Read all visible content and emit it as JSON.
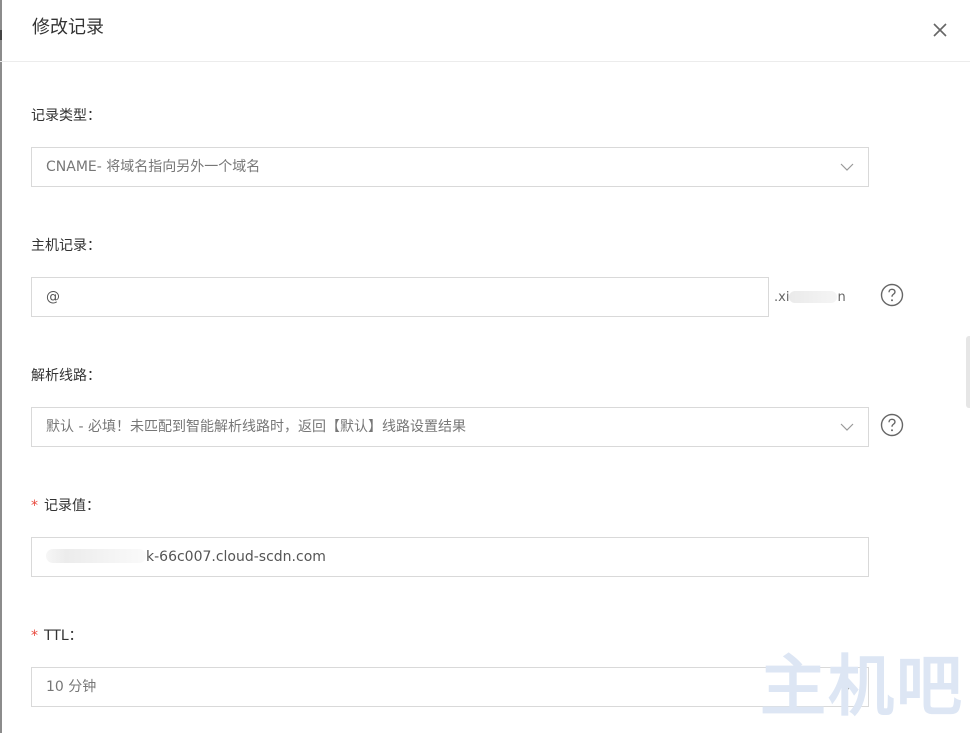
{
  "dialog": {
    "title": "修改记录"
  },
  "record_type": {
    "label": "记录类型：",
    "value": "CNAME- 将域名指向另外一个域名"
  },
  "host_record": {
    "label": "主机记录：",
    "value": "@",
    "suffix_prefix": ".xi",
    "suffix_tail": "n"
  },
  "resolution_line": {
    "label": "解析线路：",
    "value": "默认 - 必填！未匹配到智能解析线路时，返回【默认】线路设置结果"
  },
  "record_value": {
    "required_mark": "*",
    "label": "记录值：",
    "value_suffix": "k-66c007.cloud-scdn.com"
  },
  "ttl": {
    "required_mark": "*",
    "label": "TTL：",
    "value": "10 分钟"
  },
  "watermark": {
    "text": "主机吧"
  },
  "colors": {
    "required": "#e8473b",
    "border": "#d9d9d9",
    "watermark": "#dde6f4"
  }
}
